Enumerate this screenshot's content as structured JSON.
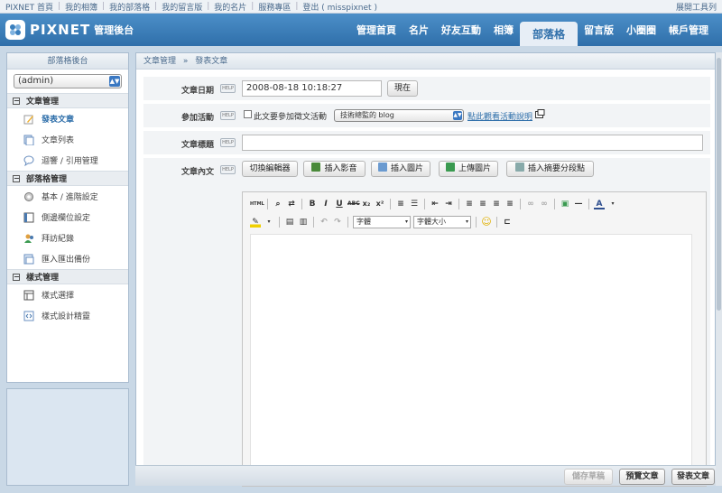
{
  "topbar": {
    "links": [
      "PIXNET 首頁",
      "我的相簿",
      "我的部落格",
      "我的留言版",
      "我的名片",
      "服務專區",
      "登出 ( misspixnet )"
    ],
    "tools": "展開工具列"
  },
  "header": {
    "brand": "PIXNET",
    "subtitle": "管理後台",
    "nav": [
      "管理首頁",
      "名片",
      "好友互動",
      "相簿",
      "部落格",
      "留言版",
      "小圈圈",
      "帳戶管理"
    ],
    "active_nav": "部落格"
  },
  "sidebar": {
    "title": "部落格後台",
    "account_select": "(admin)",
    "sections": [
      {
        "label": "文章管理",
        "toggle": "⊟",
        "items": [
          {
            "label": "發表文章",
            "icon": "edit-icon",
            "active": true
          },
          {
            "label": "文章列表",
            "icon": "list-icon",
            "active": false
          },
          {
            "label": "迴響 / 引用管理",
            "icon": "comment-icon",
            "active": false
          }
        ]
      },
      {
        "label": "部落格管理",
        "toggle": "⊟",
        "items": [
          {
            "label": "基本 / 進階設定",
            "icon": "gear-icon",
            "active": false
          },
          {
            "label": "側邊欄位設定",
            "icon": "sidebar-icon",
            "active": false
          },
          {
            "label": "拜訪紀錄",
            "icon": "visitors-icon",
            "active": false
          },
          {
            "label": "匯入匯出備份",
            "icon": "backup-icon",
            "active": false
          }
        ]
      },
      {
        "label": "樣式管理",
        "toggle": "⊟",
        "items": [
          {
            "label": "樣式選擇",
            "icon": "theme-icon",
            "active": false
          },
          {
            "label": "樣式設計精靈",
            "icon": "wizard-icon",
            "active": false
          }
        ]
      }
    ]
  },
  "breadcrumb": {
    "parent": "文章管理",
    "sep": "»",
    "current": "發表文章"
  },
  "form": {
    "help_label": "HELP",
    "date": {
      "label": "文章日期",
      "value": "2008-08-18 10:18:27",
      "now_button": "現在"
    },
    "activity": {
      "label": "參加活動",
      "checkbox_label": "此文要參加徵文活動",
      "select_value": "技術總監的 blog",
      "link": "點此觀看活動說明"
    },
    "title": {
      "label": "文章標題",
      "value": ""
    },
    "content": {
      "label": "文章內文",
      "buttons": [
        "切換編輯器",
        "插入影音",
        "插入圖片",
        "上傳圖片",
        "插入摘要分段點"
      ],
      "font_select": "字體",
      "size_select": "字體大小"
    }
  },
  "footer": {
    "save_draft": "儲存草稿",
    "preview": "預覽文章",
    "publish": "發表文章"
  },
  "colors": {
    "header": "#3a7fbd",
    "accent": "#2f6faa",
    "panel": "#c9d8e6"
  }
}
